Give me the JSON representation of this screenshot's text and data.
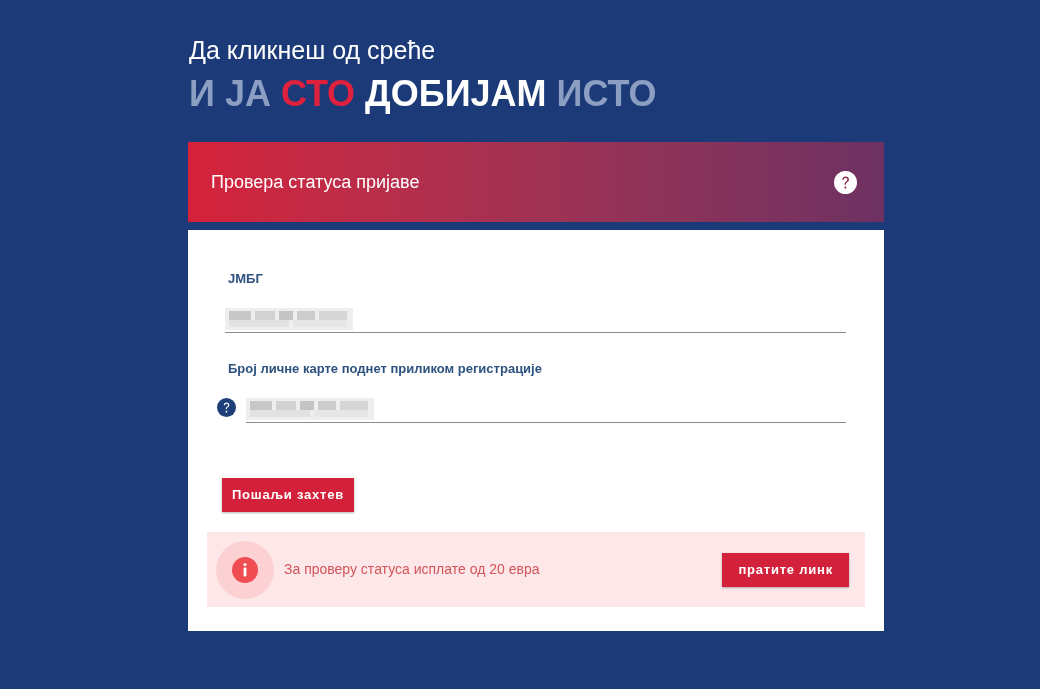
{
  "intro": "Да кликнеш од среће",
  "headline": [
    {
      "text": "И ЈА",
      "color": "#8c9fc3"
    },
    {
      "text": "СТО",
      "color": "#e0213d"
    },
    {
      "text": "ДОБИЈАМ",
      "color": "#ffffff"
    },
    {
      "text": "ИСТО",
      "color": "#8c9fc3"
    }
  ],
  "status_panel": {
    "title": "Провера статуса пријаве"
  },
  "form": {
    "fields": [
      {
        "label": "ЈМБГ",
        "kind": "plain",
        "redacted": true
      },
      {
        "label": "Број личне карте поднет приликом регистрације",
        "kind": "help",
        "redacted": true
      }
    ],
    "submit": "Пошаљи захтев"
  },
  "notice": {
    "text": "За проверу статуса исплате од 20 евра",
    "button": "пратите линк"
  }
}
